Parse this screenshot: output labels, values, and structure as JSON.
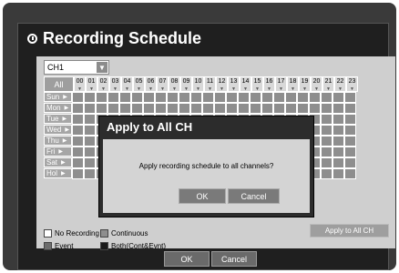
{
  "window": {
    "title": "Recording Schedule",
    "title_icon": "clock-icon"
  },
  "channel_select": {
    "value": "CH1"
  },
  "grid": {
    "all_label": "All",
    "hours": [
      "00",
      "01",
      "02",
      "03",
      "04",
      "05",
      "06",
      "07",
      "08",
      "09",
      "10",
      "11",
      "12",
      "13",
      "14",
      "15",
      "16",
      "17",
      "18",
      "19",
      "20",
      "21",
      "22",
      "23"
    ],
    "days": [
      "Sun",
      "Mon",
      "Tue",
      "Wed",
      "Thu",
      "Fri",
      "Sat",
      "Hol"
    ]
  },
  "legend": {
    "no_recording": "No Recording",
    "continuous": "Continuous",
    "event": "Event",
    "both": "Both(Cont&Evnt)"
  },
  "apply_all_button": "Apply to All CH",
  "footer": {
    "ok": "OK",
    "cancel": "Cancel"
  },
  "dialog": {
    "title": "Apply to All CH",
    "message": "Apply recording schedule to all channels?",
    "ok": "OK",
    "cancel": "Cancel"
  },
  "colors": {
    "no_recording": "#ffffff",
    "continuous": "#8e8e8e",
    "event": "#6e6e6e",
    "both": "#1a1a1a"
  }
}
